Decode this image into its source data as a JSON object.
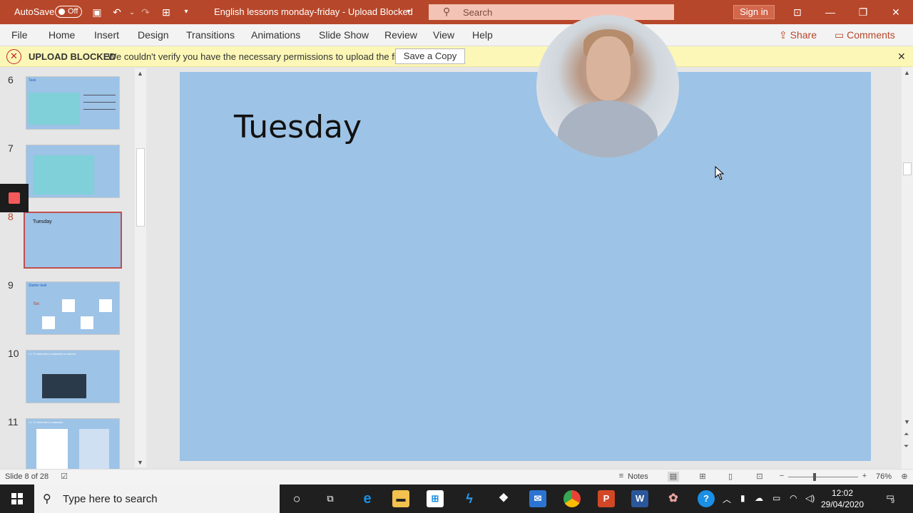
{
  "titlebar": {
    "autosave_label": "AutoSave",
    "autosave_state": "Off",
    "document_title": "English lessons monday-friday  -  Upload Blocked",
    "search_placeholder": "Search",
    "signin_label": "Sign in",
    "accent_color": "#b7472a"
  },
  "menu": {
    "items": [
      "File",
      "Home",
      "Insert",
      "Design",
      "Transitions",
      "Animations",
      "Slide Show",
      "Review",
      "View",
      "Help"
    ],
    "share_label": "Share",
    "comments_label": "Comments"
  },
  "message_bar": {
    "title": "UPLOAD BLOCKED",
    "text": "We couldn't verify you have the necessary permissions to upload the file.",
    "button_label": "Save a Copy"
  },
  "thumbnails": [
    {
      "number": "6",
      "title": "Task"
    },
    {
      "number": "7",
      "title": ""
    },
    {
      "number": "8",
      "title": "Tuesday",
      "active": true
    },
    {
      "number": "9",
      "title": "Starter task",
      "word": "fox"
    },
    {
      "number": "10",
      "title": "L1: To describe a character or animal."
    },
    {
      "number": "11",
      "title": "L1: To describe a character."
    }
  ],
  "slide": {
    "title": "Tuesday",
    "background_color": "#9dc3e6"
  },
  "statusbar": {
    "slide_info": "Slide 8 of 28",
    "notes_label": "Notes",
    "zoom_level": "76%"
  },
  "taskbar": {
    "search_placeholder": "Type here to search",
    "time": "12:02",
    "date": "29/04/2020",
    "notification_count": "9"
  }
}
